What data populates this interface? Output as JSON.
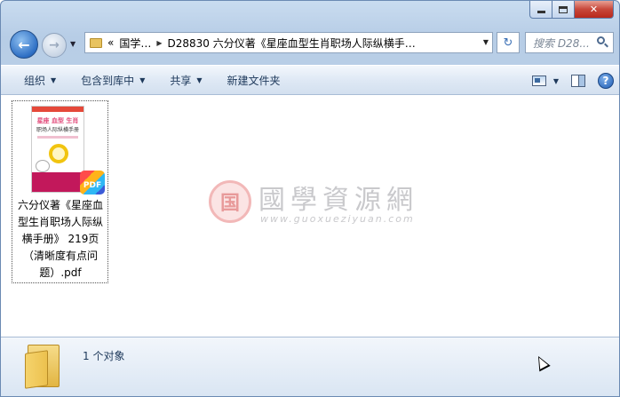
{
  "window": {
    "caption": {
      "minimize": "",
      "maximize": "",
      "close": "✕"
    }
  },
  "nav": {
    "back_glyph": "←",
    "forward_glyph": "→",
    "address": {
      "chevron": "«",
      "segments": [
        "国学…",
        "D28830 六分仪著《星座血型生肖职场人际纵横手…"
      ]
    },
    "search_placeholder": "搜索 D28..."
  },
  "toolbar": {
    "organize": "组织",
    "include_in_library": "包含到库中",
    "share": "共享",
    "new_folder": "新建文件夹"
  },
  "file": {
    "name": "六分仪著《星座血型生肖职场人际纵横手册》 219页（清晰度有点问题）.pdf",
    "thumbnail": {
      "title": "星座 血型 生肖",
      "subtitle": "职场人际纵横手册",
      "badge": "PDF"
    }
  },
  "watermark": {
    "logo_glyph": "国",
    "title": "國學資源網",
    "url": "www.guoxueziyuan.com"
  },
  "status": {
    "count": "1 个对象"
  },
  "icons": {
    "back": "back-arrow-icon",
    "forward": "forward-arrow-icon",
    "refresh": "refresh-icon",
    "search": "search-icon",
    "view": "change-view-icon",
    "preview_pane": "preview-pane-icon",
    "help": "help-icon",
    "folder": "folder-icon"
  }
}
